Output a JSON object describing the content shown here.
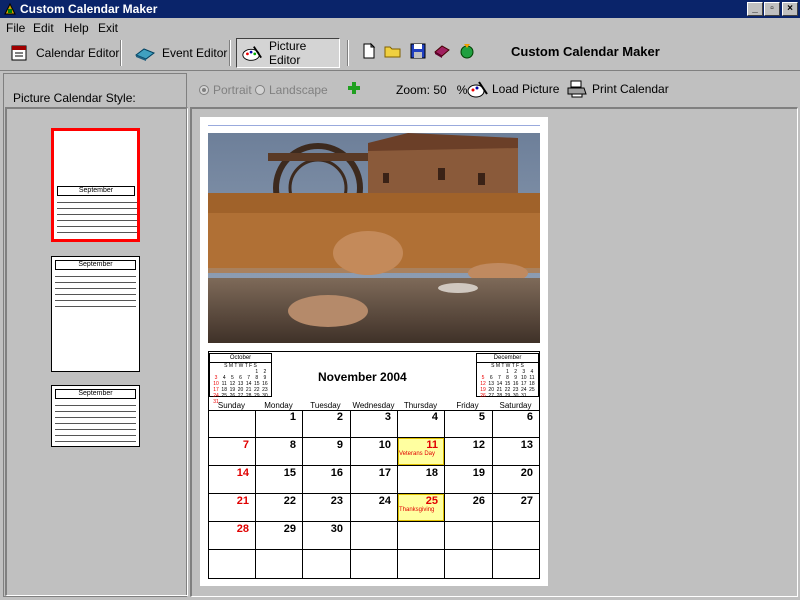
{
  "window": {
    "title": "Custom Calendar Maker"
  },
  "menu": [
    "File",
    "Edit",
    "Help",
    "Exit"
  ],
  "toolbar": {
    "calendar_editor": "Calendar Editor",
    "event_editor": "Event Editor",
    "picture_editor": "Picture Editor",
    "app_name": "Custom Calendar Maker"
  },
  "left_panel": {
    "label": "Picture Calendar Style:"
  },
  "thumbnails": [
    {
      "month": "September"
    },
    {
      "month": "September"
    },
    {
      "month": "September"
    }
  ],
  "options": {
    "portrait": "Portrait",
    "landscape": "Landscape",
    "zoom_label": "Zoom: 50",
    "zoom_unit": "%",
    "load_picture": "Load Picture",
    "print_calendar": "Print Calendar"
  },
  "calendar": {
    "title": "November 2004",
    "prev_mini": {
      "name": "October",
      "days": "S M T W T F S"
    },
    "next_mini": {
      "name": "December",
      "days": "S M T W T F S"
    },
    "weekdays": [
      "Sunday",
      "Monday",
      "Tuesday",
      "Wednesday",
      "Thursday",
      "Friday",
      "Saturday"
    ],
    "weeks": [
      [
        "",
        "1",
        "2",
        "3",
        "4",
        "5",
        "6"
      ],
      [
        "7",
        "8",
        "9",
        "10",
        "11",
        "12",
        "13"
      ],
      [
        "14",
        "15",
        "16",
        "17",
        "18",
        "19",
        "20"
      ],
      [
        "21",
        "22",
        "23",
        "24",
        "25",
        "26",
        "27"
      ],
      [
        "28",
        "29",
        "30",
        "",
        "",
        "",
        ""
      ],
      [
        "",
        "",
        "",
        "",
        "",
        "",
        ""
      ]
    ],
    "events": {
      "veterans": "Veterans Day",
      "thanksgiving": "Thanksgiving"
    }
  },
  "colors": {
    "title_bar": "#0a246a",
    "sunday_red": "#e00000",
    "highlight": "#ffffa0",
    "selected_border": "#ff0000"
  }
}
